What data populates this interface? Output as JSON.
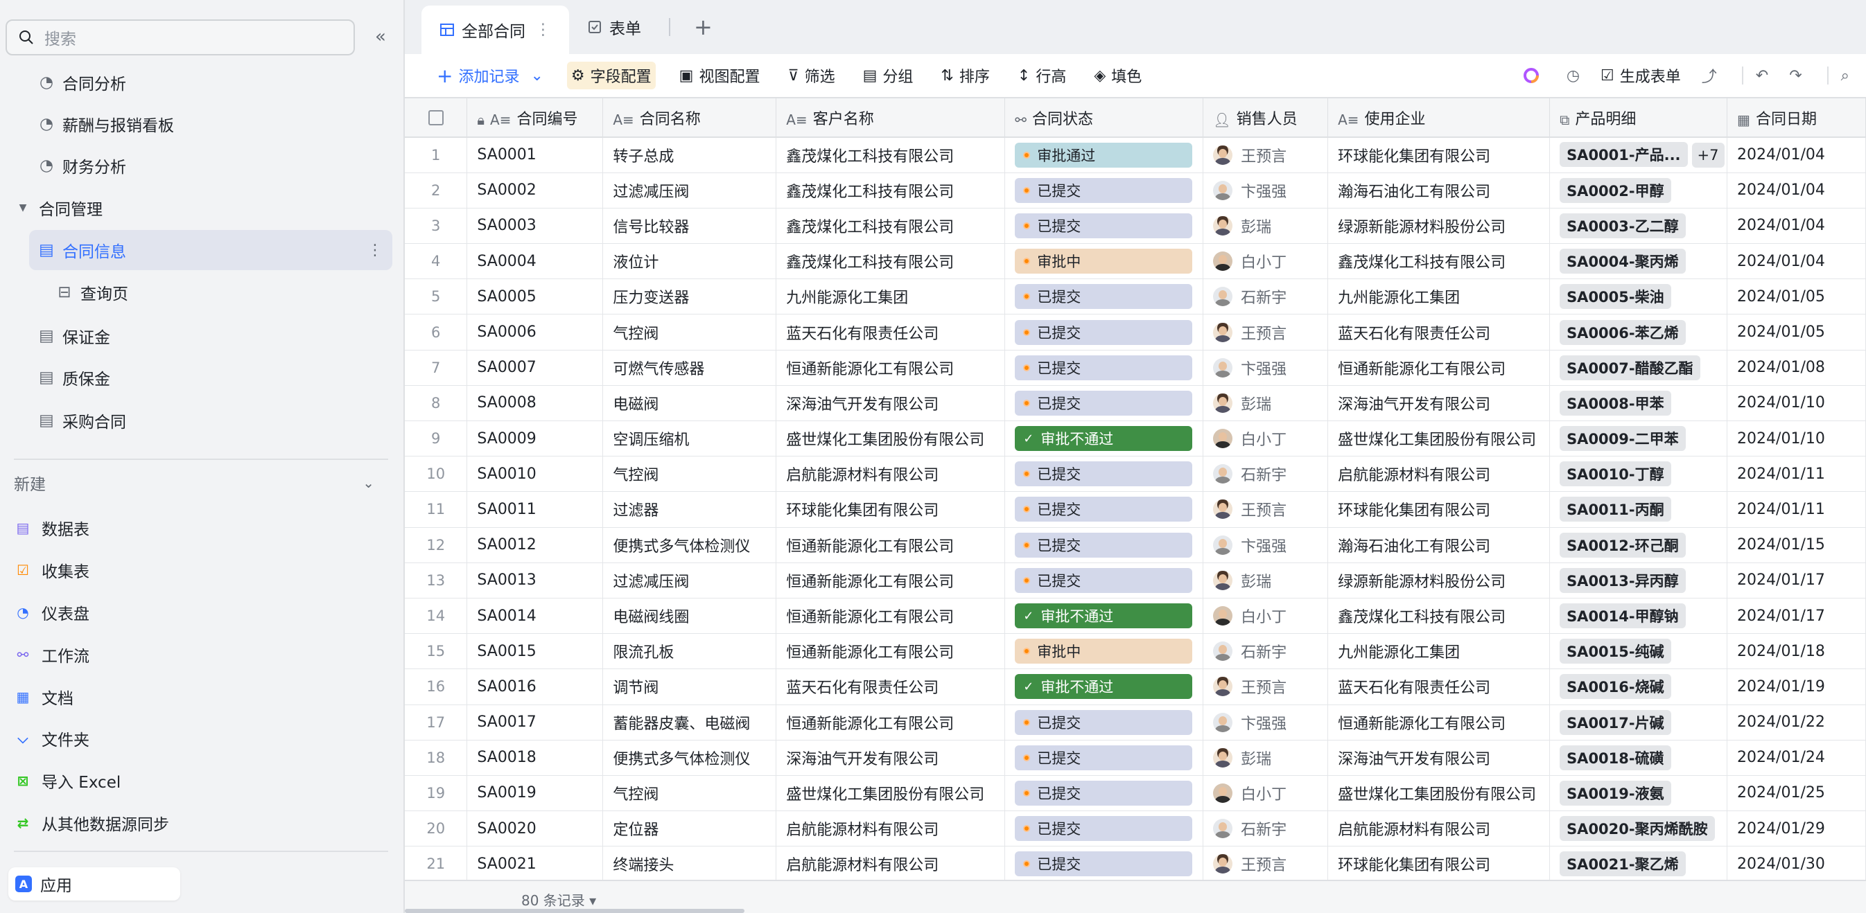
{
  "sidebar": {
    "search_placeholder": "搜索",
    "tree": [
      {
        "label": "合同分析",
        "icon": "dashboard-icon"
      },
      {
        "label": "薪酬与报销看板",
        "icon": "dashboard-icon"
      },
      {
        "label": "财务分析",
        "icon": "dashboard-icon"
      },
      {
        "label": "合同管理",
        "icon": "folder-caret-icon"
      },
      {
        "label": "合同信息",
        "icon": "table-icon"
      },
      {
        "label": "查询页",
        "icon": "query-icon"
      },
      {
        "label": "保证金",
        "icon": "table-icon"
      },
      {
        "label": "质保金",
        "icon": "table-icon"
      },
      {
        "label": "采购合同",
        "icon": "table-icon"
      }
    ],
    "new_label": "新建",
    "new_items": [
      {
        "label": "数据表",
        "icon": "table-icon",
        "color": "#7b67ee"
      },
      {
        "label": "收集表",
        "icon": "form-icon",
        "color": "#ff8800"
      },
      {
        "label": "仪表盘",
        "icon": "dashboard-icon",
        "color": "#3370ff"
      },
      {
        "label": "工作流",
        "icon": "workflow-icon",
        "color": "#7b67ee"
      },
      {
        "label": "文档",
        "icon": "doc-icon",
        "color": "#3370ff"
      },
      {
        "label": "文件夹",
        "icon": "folder-icon",
        "color": "#3370ff"
      },
      {
        "label": "导入 Excel",
        "icon": "excel-icon",
        "color": "#34c724"
      },
      {
        "label": "从其他数据源同步",
        "icon": "sync-icon",
        "color": "#34c724"
      }
    ],
    "app_label": "应用"
  },
  "tabs": [
    {
      "label": "全部合同",
      "active": true
    },
    {
      "label": "表单",
      "active": false
    }
  ],
  "toolbar": {
    "add_record": "添加记录",
    "field_config": "字段配置",
    "view_config": "视图配置",
    "filter": "筛选",
    "group": "分组",
    "sort": "排序",
    "row_height": "行高",
    "fill_color": "填色",
    "generate_form": "生成表单"
  },
  "columns": [
    "合同编号",
    "合同名称",
    "客户名称",
    "合同状态",
    "销售人员",
    "使用企业",
    "产品明细",
    "合同日期"
  ],
  "rows": [
    {
      "n": "1",
      "id": "SA0001",
      "name": "转子总成",
      "customer": "鑫茂煤化工科技有限公司",
      "status": "审批通过",
      "st": "pass",
      "sales": "王预言",
      "av": "f",
      "company": "环球能化集团有限公司",
      "product": "SA0001-产品...",
      "extra": "+7",
      "date": "2024/01/04"
    },
    {
      "n": "2",
      "id": "SA0002",
      "name": "过滤减压阀",
      "customer": "鑫茂煤化工科技有限公司",
      "status": "已提交",
      "st": "sub",
      "sales": "卞强强",
      "av": "m2",
      "company": "瀚海石油化工有限公司",
      "product": "SA0002-甲醇",
      "extra": "",
      "date": "2024/01/04"
    },
    {
      "n": "3",
      "id": "SA0003",
      "name": "信号比较器",
      "customer": "鑫茂煤化工科技有限公司",
      "status": "已提交",
      "st": "sub",
      "sales": "彭瑞",
      "av": "f",
      "company": "绿源新能源材料股份公司",
      "product": "SA0003-乙二醇",
      "extra": "",
      "date": "2024/01/04"
    },
    {
      "n": "4",
      "id": "SA0004",
      "name": "液位计",
      "customer": "鑫茂煤化工科技有限公司",
      "status": "审批中",
      "st": "mid",
      "sales": "白小丁",
      "av": "m3",
      "company": "鑫茂煤化工科技有限公司",
      "product": "SA0004-聚丙烯",
      "extra": "",
      "date": "2024/01/04"
    },
    {
      "n": "5",
      "id": "SA0005",
      "name": "压力变送器",
      "customer": "九州能源化工集团",
      "status": "已提交",
      "st": "sub",
      "sales": "石新宇",
      "av": "m2",
      "company": "九州能源化工集团",
      "product": "SA0005-柴油",
      "extra": "",
      "date": "2024/01/05"
    },
    {
      "n": "6",
      "id": "SA0006",
      "name": "气控阀",
      "customer": "蓝天石化有限责任公司",
      "status": "已提交",
      "st": "sub",
      "sales": "王预言",
      "av": "f",
      "company": "蓝天石化有限责任公司",
      "product": "SA0006-苯乙烯",
      "extra": "",
      "date": "2024/01/05"
    },
    {
      "n": "7",
      "id": "SA0007",
      "name": "可燃气传感器",
      "customer": "恒通新能源化工有限公司",
      "status": "已提交",
      "st": "sub",
      "sales": "卞强强",
      "av": "m2",
      "company": "恒通新能源化工有限公司",
      "product": "SA0007-醋酸乙酯",
      "extra": "",
      "date": "2024/01/08"
    },
    {
      "n": "8",
      "id": "SA0008",
      "name": "电磁阀",
      "customer": "深海油气开发有限公司",
      "status": "已提交",
      "st": "sub",
      "sales": "彭瑞",
      "av": "f",
      "company": "深海油气开发有限公司",
      "product": "SA0008-甲苯",
      "extra": "",
      "date": "2024/01/10"
    },
    {
      "n": "9",
      "id": "SA0009",
      "name": "空调压缩机",
      "customer": "盛世煤化工集团股份有限公司",
      "status": "审批不通过",
      "st": "fail",
      "sales": "白小丁",
      "av": "m3",
      "company": "盛世煤化工集团股份有限公司",
      "product": "SA0009-二甲苯",
      "extra": "",
      "date": "2024/01/10"
    },
    {
      "n": "10",
      "id": "SA0010",
      "name": "气控阀",
      "customer": "启航能源材料有限公司",
      "status": "已提交",
      "st": "sub",
      "sales": "石新宇",
      "av": "m2",
      "company": "启航能源材料有限公司",
      "product": "SA0010-丁醇",
      "extra": "",
      "date": "2024/01/11"
    },
    {
      "n": "11",
      "id": "SA0011",
      "name": "过滤器",
      "customer": "环球能化集团有限公司",
      "status": "已提交",
      "st": "sub",
      "sales": "王预言",
      "av": "f",
      "company": "环球能化集团有限公司",
      "product": "SA0011-丙酮",
      "extra": "",
      "date": "2024/01/11"
    },
    {
      "n": "12",
      "id": "SA0012",
      "name": "便携式多气体检测仪",
      "customer": "恒通新能源化工有限公司",
      "status": "已提交",
      "st": "sub",
      "sales": "卞强强",
      "av": "m2",
      "company": "瀚海石油化工有限公司",
      "product": "SA0012-环己酮",
      "extra": "",
      "date": "2024/01/15"
    },
    {
      "n": "13",
      "id": "SA0013",
      "name": "过滤减压阀",
      "customer": "恒通新能源化工有限公司",
      "status": "已提交",
      "st": "sub",
      "sales": "彭瑞",
      "av": "f",
      "company": "绿源新能源材料股份公司",
      "product": "SA0013-异丙醇",
      "extra": "",
      "date": "2024/01/17"
    },
    {
      "n": "14",
      "id": "SA0014",
      "name": "电磁阀线圈",
      "customer": "恒通新能源化工有限公司",
      "status": "审批不通过",
      "st": "fail",
      "sales": "白小丁",
      "av": "m3",
      "company": "鑫茂煤化工科技有限公司",
      "product": "SA0014-甲醇钠",
      "extra": "",
      "date": "2024/01/17"
    },
    {
      "n": "15",
      "id": "SA0015",
      "name": "限流孔板",
      "customer": "恒通新能源化工有限公司",
      "status": "审批中",
      "st": "mid",
      "sales": "石新宇",
      "av": "m2",
      "company": "九州能源化工集团",
      "product": "SA0015-纯碱",
      "extra": "",
      "date": "2024/01/18"
    },
    {
      "n": "16",
      "id": "SA0016",
      "name": "调节阀",
      "customer": "蓝天石化有限责任公司",
      "status": "审批不通过",
      "st": "fail",
      "sales": "王预言",
      "av": "f",
      "company": "蓝天石化有限责任公司",
      "product": "SA0016-烧碱",
      "extra": "",
      "date": "2024/01/19"
    },
    {
      "n": "17",
      "id": "SA0017",
      "name": "蓄能器皮囊、电磁阀",
      "customer": "恒通新能源化工有限公司",
      "status": "已提交",
      "st": "sub",
      "sales": "卞强强",
      "av": "m2",
      "company": "恒通新能源化工有限公司",
      "product": "SA0017-片碱",
      "extra": "",
      "date": "2024/01/22"
    },
    {
      "n": "18",
      "id": "SA0018",
      "name": "便携式多气体检测仪",
      "customer": "深海油气开发有限公司",
      "status": "已提交",
      "st": "sub",
      "sales": "彭瑞",
      "av": "f",
      "company": "深海油气开发有限公司",
      "product": "SA0018-硫磺",
      "extra": "",
      "date": "2024/01/24"
    },
    {
      "n": "19",
      "id": "SA0019",
      "name": "气控阀",
      "customer": "盛世煤化工集团股份有限公司",
      "status": "已提交",
      "st": "sub",
      "sales": "白小丁",
      "av": "m3",
      "company": "盛世煤化工集团股份有限公司",
      "product": "SA0019-液氨",
      "extra": "",
      "date": "2024/01/25"
    },
    {
      "n": "20",
      "id": "SA0020",
      "name": "定位器",
      "customer": "启航能源材料有限公司",
      "status": "已提交",
      "st": "sub",
      "sales": "石新宇",
      "av": "m2",
      "company": "启航能源材料有限公司",
      "product": "SA0020-聚丙烯酰胺",
      "extra": "",
      "date": "2024/01/29"
    },
    {
      "n": "21",
      "id": "SA0021",
      "name": "终端接头",
      "customer": "启航能源材料有限公司",
      "status": "已提交",
      "st": "sub",
      "sales": "王预言",
      "av": "f",
      "company": "环球能化集团有限公司",
      "product": "SA0021-聚乙烯",
      "extra": "",
      "date": "2024/01/30"
    }
  ],
  "footer": {
    "record_count": "80 条记录"
  },
  "colors": {
    "accent": "#3370ff",
    "status_fail": "#3f8f45",
    "status_pass": "#bcdbe2",
    "status_submitted": "#d3d8ea",
    "status_pending": "#f1d9bf"
  }
}
